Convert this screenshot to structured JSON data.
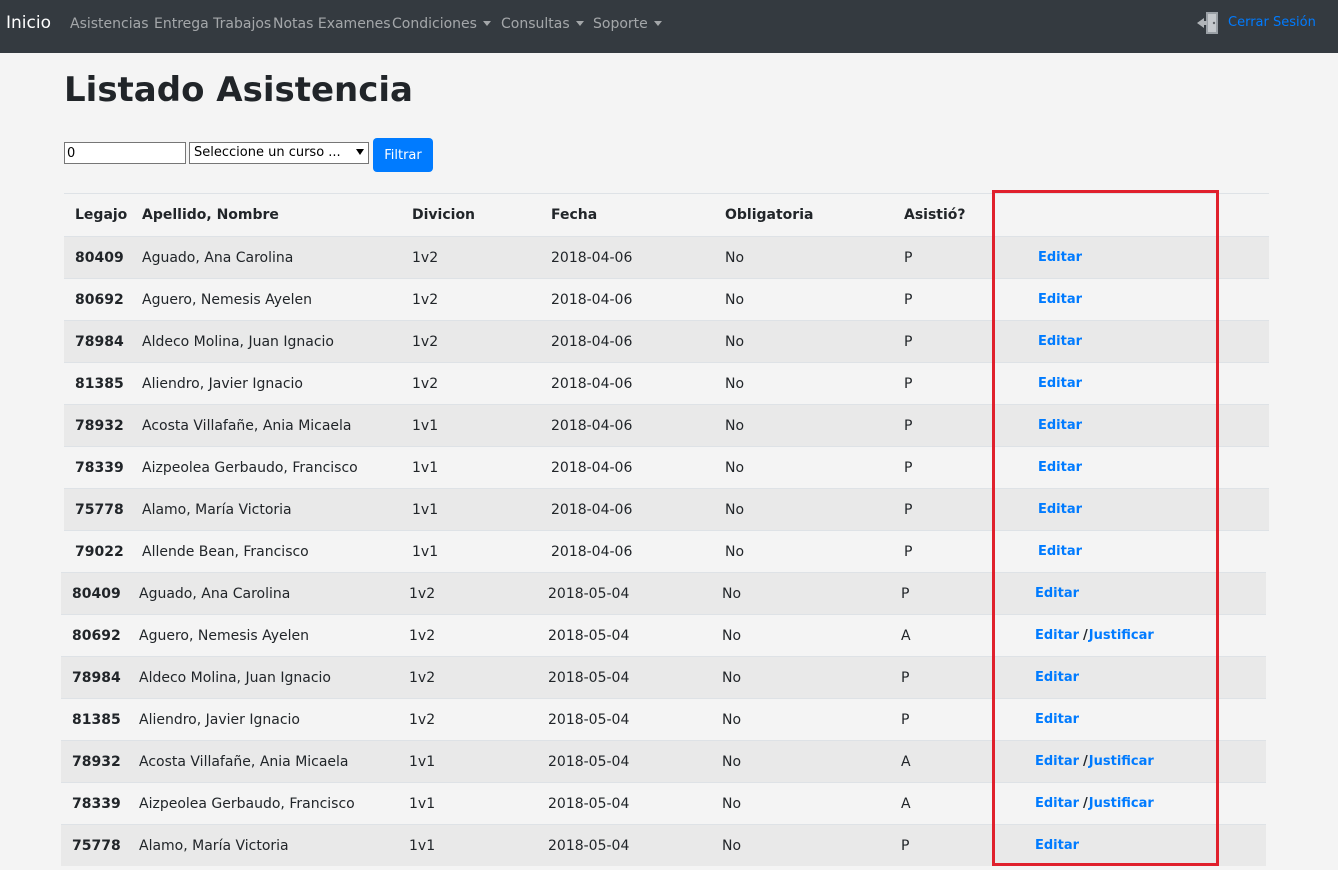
{
  "navbar": {
    "brand": "Inicio",
    "items": [
      {
        "label": "Asistencias",
        "dropdown": false
      },
      {
        "label": "Entrega Trabajos",
        "dropdown": false
      },
      {
        "label": "Notas Examenes",
        "dropdown": false
      },
      {
        "label": "Condiciones",
        "dropdown": true
      },
      {
        "label": "Consultas",
        "dropdown": true
      },
      {
        "label": "Soporte",
        "dropdown": true
      }
    ],
    "logout_label": "Cerrar Sesión",
    "logout_icon": "logout-door-icon"
  },
  "page": {
    "title": "Listado Asistencia"
  },
  "filter": {
    "input_value": "0",
    "select_value": "Seleccione un curso ...",
    "button_label": "Filtrar"
  },
  "table": {
    "headers": [
      "Legajo",
      "Apellido, Nombre",
      "Divicion",
      "Fecha",
      "Obligatoria",
      "Asistió?"
    ],
    "edit_label": "Editar",
    "separator": "/",
    "justify_label": "Justificar",
    "rows": [
      {
        "legajo": "80409",
        "nombre": "Aguado, Ana Carolina",
        "division": "1v2",
        "fecha": "2018-04-06",
        "obligatoria": "No",
        "asistio": "P",
        "justificar": false
      },
      {
        "legajo": "80692",
        "nombre": "Aguero, Nemesis Ayelen",
        "division": "1v2",
        "fecha": "2018-04-06",
        "obligatoria": "No",
        "asistio": "P",
        "justificar": false
      },
      {
        "legajo": "78984",
        "nombre": "Aldeco Molina, Juan Ignacio",
        "division": "1v2",
        "fecha": "2018-04-06",
        "obligatoria": "No",
        "asistio": "P",
        "justificar": false
      },
      {
        "legajo": "81385",
        "nombre": "Aliendro, Javier Ignacio",
        "division": "1v2",
        "fecha": "2018-04-06",
        "obligatoria": "No",
        "asistio": "P",
        "justificar": false
      },
      {
        "legajo": "78932",
        "nombre": "Acosta Villafañe, Ania Micaela",
        "division": "1v1",
        "fecha": "2018-04-06",
        "obligatoria": "No",
        "asistio": "P",
        "justificar": false
      },
      {
        "legajo": "78339",
        "nombre": "Aizpeolea Gerbaudo, Francisco",
        "division": "1v1",
        "fecha": "2018-04-06",
        "obligatoria": "No",
        "asistio": "P",
        "justificar": false
      },
      {
        "legajo": "75778",
        "nombre": "Alamo, María Victoria",
        "division": "1v1",
        "fecha": "2018-04-06",
        "obligatoria": "No",
        "asistio": "P",
        "justificar": false
      },
      {
        "legajo": "79022",
        "nombre": "Allende Bean, Francisco",
        "division": "1v1",
        "fecha": "2018-04-06",
        "obligatoria": "No",
        "asistio": "P",
        "justificar": false
      },
      {
        "legajo": "80409",
        "nombre": "Aguado, Ana Carolina",
        "division": "1v2",
        "fecha": "2018-05-04",
        "obligatoria": "No",
        "asistio": "P",
        "justificar": false
      },
      {
        "legajo": "80692",
        "nombre": "Aguero, Nemesis Ayelen",
        "division": "1v2",
        "fecha": "2018-05-04",
        "obligatoria": "No",
        "asistio": "A",
        "justificar": true
      },
      {
        "legajo": "78984",
        "nombre": "Aldeco Molina, Juan Ignacio",
        "division": "1v2",
        "fecha": "2018-05-04",
        "obligatoria": "No",
        "asistio": "P",
        "justificar": false
      },
      {
        "legajo": "81385",
        "nombre": "Aliendro, Javier Ignacio",
        "division": "1v2",
        "fecha": "2018-05-04",
        "obligatoria": "No",
        "asistio": "P",
        "justificar": false
      },
      {
        "legajo": "78932",
        "nombre": "Acosta Villafañe, Ania Micaela",
        "division": "1v1",
        "fecha": "2018-05-04",
        "obligatoria": "No",
        "asistio": "A",
        "justificar": true
      },
      {
        "legajo": "78339",
        "nombre": "Aizpeolea Gerbaudo, Francisco",
        "division": "1v1",
        "fecha": "2018-05-04",
        "obligatoria": "No",
        "asistio": "A",
        "justificar": true
      },
      {
        "legajo": "75778",
        "nombre": "Alamo, María Victoria",
        "division": "1v1",
        "fecha": "2018-05-04",
        "obligatoria": "No",
        "asistio": "P",
        "justificar": false
      }
    ]
  },
  "colors": {
    "navbar_bg": "#343a40",
    "link": "#007bff",
    "highlight_border": "#e0202c"
  }
}
